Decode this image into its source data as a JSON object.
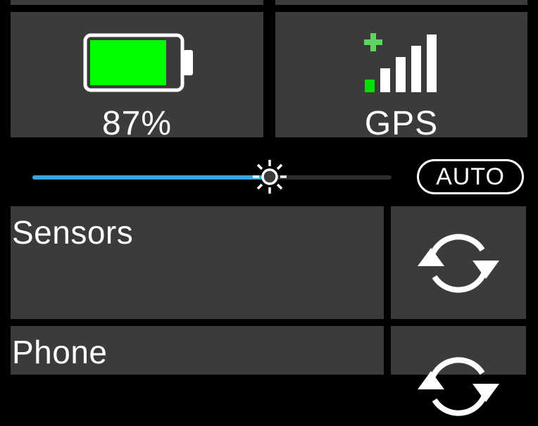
{
  "battery": {
    "percent_label": "87%",
    "level_percent": 87,
    "fill_color": "#00ff00",
    "icon": "battery-icon"
  },
  "gps": {
    "label": "GPS",
    "icon": "gps-signal-icon",
    "accent_color": "#5fd35f"
  },
  "brightness": {
    "level_percent": 65,
    "track_color": "#37a9d8",
    "auto_label": "AUTO",
    "thumb_icon": "sun-icon"
  },
  "rows": {
    "sensors": {
      "label": "Sensors",
      "action_icon": "sync-icon"
    },
    "phone": {
      "label": "Phone",
      "action_icon": "sync-icon"
    }
  }
}
